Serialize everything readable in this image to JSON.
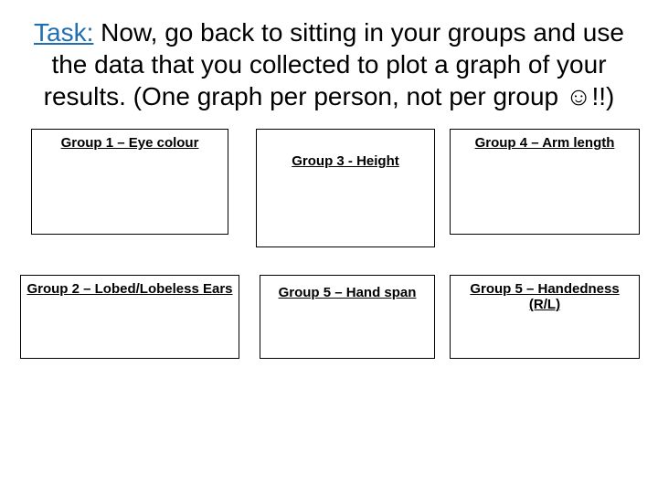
{
  "heading": {
    "task_label": "Task:",
    "text": " Now, go back to sitting in your groups and use the data that you collected to plot a graph of your results. (One graph per person, not per group ☺!!)"
  },
  "boxes": {
    "group1": "Group 1 – Eye colour",
    "group2": "Group 2 – Lobed/Lobeless Ears",
    "group3": "Group 3 - Height",
    "group4": "Group 4 – Arm length",
    "group5a": "Group 5 – Hand span",
    "group5b": "Group 5 – Handedness (R/L)"
  }
}
